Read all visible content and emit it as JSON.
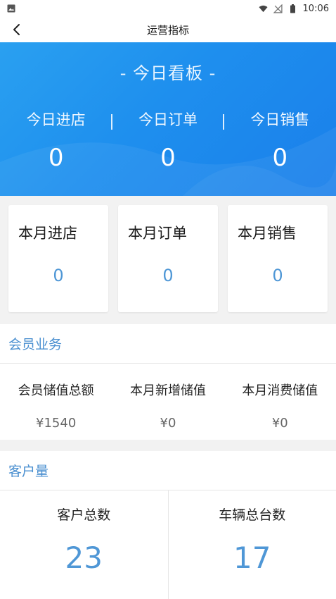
{
  "status_bar": {
    "time": "10:06"
  },
  "nav": {
    "title": "运营指标"
  },
  "today": {
    "title": "- 今日看板 -",
    "stats": [
      {
        "label": "今日进店",
        "value": "0"
      },
      {
        "label": "今日订单",
        "value": "0"
      },
      {
        "label": "今日销售",
        "value": "0"
      }
    ]
  },
  "month": {
    "cards": [
      {
        "label": "本月进店",
        "value": "0"
      },
      {
        "label": "本月订单",
        "value": "0"
      },
      {
        "label": "本月销售",
        "value": "0"
      }
    ]
  },
  "member": {
    "title": "会员业务",
    "items": [
      {
        "label": "会员储值总额",
        "value": "¥1540"
      },
      {
        "label": "本月新增储值",
        "value": "¥0"
      },
      {
        "label": "本月消费储值",
        "value": "¥0"
      }
    ]
  },
  "customer": {
    "title": "客户量",
    "items": [
      {
        "label": "客户总数",
        "value": "23"
      },
      {
        "label": "车辆总台数",
        "value": "17"
      }
    ]
  },
  "colors": {
    "accent": "#4f97d6",
    "hero_blue": "#1e8fee",
    "section_title": "#4a8fd0"
  }
}
